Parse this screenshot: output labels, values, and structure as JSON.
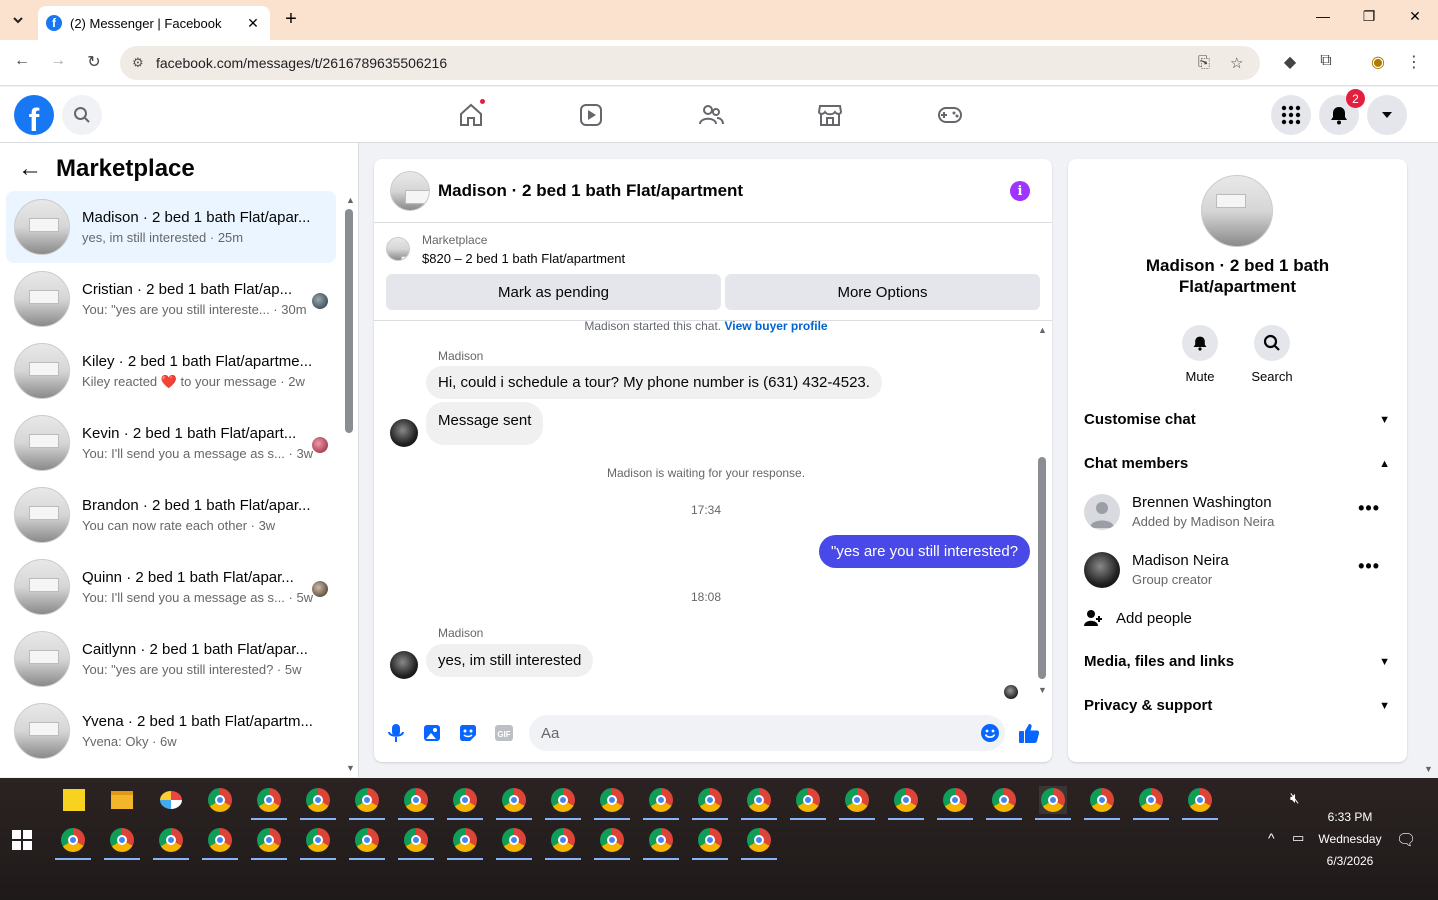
{
  "browser": {
    "tab_title": "(2) Messenger | Facebook",
    "url": "facebook.com/messages/t/2616789635506216"
  },
  "fb": {
    "notif_count": "2"
  },
  "sidebar": {
    "title": "Marketplace",
    "conversations": [
      {
        "name": "Madison · 2 bed 1 bath Flat/apar...",
        "snippet": "yes, im still interested · 25m",
        "active": true
      },
      {
        "name": "Cristian · 2 bed 1 bath Flat/ap...",
        "snippet": "You: \"yes are you still intereste... · 30m"
      },
      {
        "name": "Kiley · 2 bed 1 bath Flat/apartme...",
        "snippet": "Kiley reacted ❤️ to your message · 2w"
      },
      {
        "name": "Kevin · 2 bed 1 bath Flat/apart...",
        "snippet": "You: I'll send you a message as s... · 3w"
      },
      {
        "name": "Brandon · 2 bed 1 bath Flat/apar...",
        "snippet": "You can now rate each other · 3w"
      },
      {
        "name": "Quinn · 2 bed 1 bath Flat/apar...",
        "snippet": "You: I'll send you a message as s... · 5w"
      },
      {
        "name": "Caitlynn · 2 bed 1 bath Flat/apar...",
        "snippet": "You: \"yes are you still interested? · 5w"
      },
      {
        "name": "Yvena · 2 bed 1 bath Flat/apartm...",
        "snippet": "Yvena: Oky · 6w"
      }
    ]
  },
  "chat": {
    "title": "Madison · 2 bed 1 bath Flat/apartment",
    "listing_category": "Marketplace",
    "listing_price": "$820 – 2 bed 1 bath Flat/apartment",
    "mark_pending": "Mark as pending",
    "more_options": "More Options",
    "started_text": "Madison started this chat.",
    "view_buyer": "View buyer profile",
    "sender_name": "Madison",
    "msg1": "Hi, could i schedule a tour? My phone number is (631) 432-4523.",
    "msg2": "Message sent",
    "waiting": "Madison is waiting for your response.",
    "time1": "17:34",
    "out1": "\"yes are you still interested?",
    "time2": "18:08",
    "msg3": "yes, im still interested",
    "placeholder": "Aa"
  },
  "info": {
    "title": "Madison · 2 bed 1 bath Flat/apartment",
    "mute": "Mute",
    "search": "Search",
    "customise": "Customise chat",
    "members_heading": "Chat members",
    "members": [
      {
        "name": "Brennen Washington",
        "role": "Added by Madison Neira"
      },
      {
        "name": "Madison Neira",
        "role": "Group creator"
      }
    ],
    "add_people": "Add people",
    "media": "Media, files and links",
    "privacy": "Privacy & support"
  },
  "taskbar": {
    "time": "6:33 PM",
    "day": "Wednesday",
    "date": "6/3/2026"
  },
  "colors": {
    "fb_blue": "#1877f2",
    "outgoing_bubble": "#4849e6",
    "info_purple": "#a033ff"
  }
}
